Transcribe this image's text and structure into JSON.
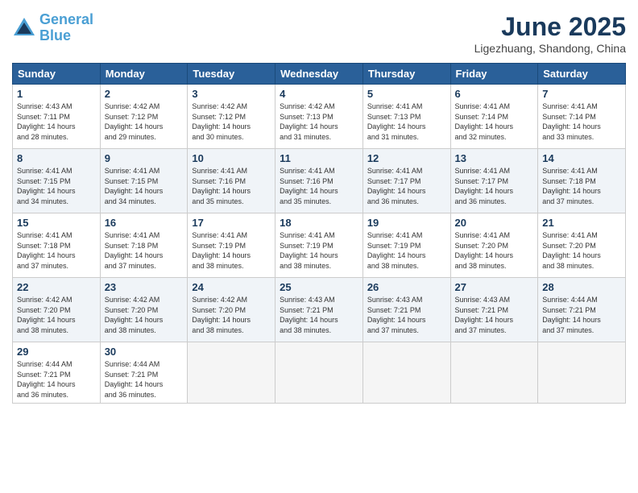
{
  "header": {
    "logo_line1": "General",
    "logo_line2": "Blue",
    "title": "June 2025",
    "subtitle": "Ligezhuang, Shandong, China"
  },
  "weekdays": [
    "Sunday",
    "Monday",
    "Tuesday",
    "Wednesday",
    "Thursday",
    "Friday",
    "Saturday"
  ],
  "weeks": [
    [
      {
        "day": "1",
        "info": "Sunrise: 4:43 AM\nSunset: 7:11 PM\nDaylight: 14 hours\nand 28 minutes."
      },
      {
        "day": "2",
        "info": "Sunrise: 4:42 AM\nSunset: 7:12 PM\nDaylight: 14 hours\nand 29 minutes."
      },
      {
        "day": "3",
        "info": "Sunrise: 4:42 AM\nSunset: 7:12 PM\nDaylight: 14 hours\nand 30 minutes."
      },
      {
        "day": "4",
        "info": "Sunrise: 4:42 AM\nSunset: 7:13 PM\nDaylight: 14 hours\nand 31 minutes."
      },
      {
        "day": "5",
        "info": "Sunrise: 4:41 AM\nSunset: 7:13 PM\nDaylight: 14 hours\nand 31 minutes."
      },
      {
        "day": "6",
        "info": "Sunrise: 4:41 AM\nSunset: 7:14 PM\nDaylight: 14 hours\nand 32 minutes."
      },
      {
        "day": "7",
        "info": "Sunrise: 4:41 AM\nSunset: 7:14 PM\nDaylight: 14 hours\nand 33 minutes."
      }
    ],
    [
      {
        "day": "8",
        "info": "Sunrise: 4:41 AM\nSunset: 7:15 PM\nDaylight: 14 hours\nand 34 minutes."
      },
      {
        "day": "9",
        "info": "Sunrise: 4:41 AM\nSunset: 7:15 PM\nDaylight: 14 hours\nand 34 minutes."
      },
      {
        "day": "10",
        "info": "Sunrise: 4:41 AM\nSunset: 7:16 PM\nDaylight: 14 hours\nand 35 minutes."
      },
      {
        "day": "11",
        "info": "Sunrise: 4:41 AM\nSunset: 7:16 PM\nDaylight: 14 hours\nand 35 minutes."
      },
      {
        "day": "12",
        "info": "Sunrise: 4:41 AM\nSunset: 7:17 PM\nDaylight: 14 hours\nand 36 minutes."
      },
      {
        "day": "13",
        "info": "Sunrise: 4:41 AM\nSunset: 7:17 PM\nDaylight: 14 hours\nand 36 minutes."
      },
      {
        "day": "14",
        "info": "Sunrise: 4:41 AM\nSunset: 7:18 PM\nDaylight: 14 hours\nand 37 minutes."
      }
    ],
    [
      {
        "day": "15",
        "info": "Sunrise: 4:41 AM\nSunset: 7:18 PM\nDaylight: 14 hours\nand 37 minutes."
      },
      {
        "day": "16",
        "info": "Sunrise: 4:41 AM\nSunset: 7:18 PM\nDaylight: 14 hours\nand 37 minutes."
      },
      {
        "day": "17",
        "info": "Sunrise: 4:41 AM\nSunset: 7:19 PM\nDaylight: 14 hours\nand 38 minutes."
      },
      {
        "day": "18",
        "info": "Sunrise: 4:41 AM\nSunset: 7:19 PM\nDaylight: 14 hours\nand 38 minutes."
      },
      {
        "day": "19",
        "info": "Sunrise: 4:41 AM\nSunset: 7:19 PM\nDaylight: 14 hours\nand 38 minutes."
      },
      {
        "day": "20",
        "info": "Sunrise: 4:41 AM\nSunset: 7:20 PM\nDaylight: 14 hours\nand 38 minutes."
      },
      {
        "day": "21",
        "info": "Sunrise: 4:41 AM\nSunset: 7:20 PM\nDaylight: 14 hours\nand 38 minutes."
      }
    ],
    [
      {
        "day": "22",
        "info": "Sunrise: 4:42 AM\nSunset: 7:20 PM\nDaylight: 14 hours\nand 38 minutes."
      },
      {
        "day": "23",
        "info": "Sunrise: 4:42 AM\nSunset: 7:20 PM\nDaylight: 14 hours\nand 38 minutes."
      },
      {
        "day": "24",
        "info": "Sunrise: 4:42 AM\nSunset: 7:20 PM\nDaylight: 14 hours\nand 38 minutes."
      },
      {
        "day": "25",
        "info": "Sunrise: 4:43 AM\nSunset: 7:21 PM\nDaylight: 14 hours\nand 38 minutes."
      },
      {
        "day": "26",
        "info": "Sunrise: 4:43 AM\nSunset: 7:21 PM\nDaylight: 14 hours\nand 37 minutes."
      },
      {
        "day": "27",
        "info": "Sunrise: 4:43 AM\nSunset: 7:21 PM\nDaylight: 14 hours\nand 37 minutes."
      },
      {
        "day": "28",
        "info": "Sunrise: 4:44 AM\nSunset: 7:21 PM\nDaylight: 14 hours\nand 37 minutes."
      }
    ],
    [
      {
        "day": "29",
        "info": "Sunrise: 4:44 AM\nSunset: 7:21 PM\nDaylight: 14 hours\nand 36 minutes."
      },
      {
        "day": "30",
        "info": "Sunrise: 4:44 AM\nSunset: 7:21 PM\nDaylight: 14 hours\nand 36 minutes."
      },
      {
        "day": "",
        "info": ""
      },
      {
        "day": "",
        "info": ""
      },
      {
        "day": "",
        "info": ""
      },
      {
        "day": "",
        "info": ""
      },
      {
        "day": "",
        "info": ""
      }
    ]
  ]
}
